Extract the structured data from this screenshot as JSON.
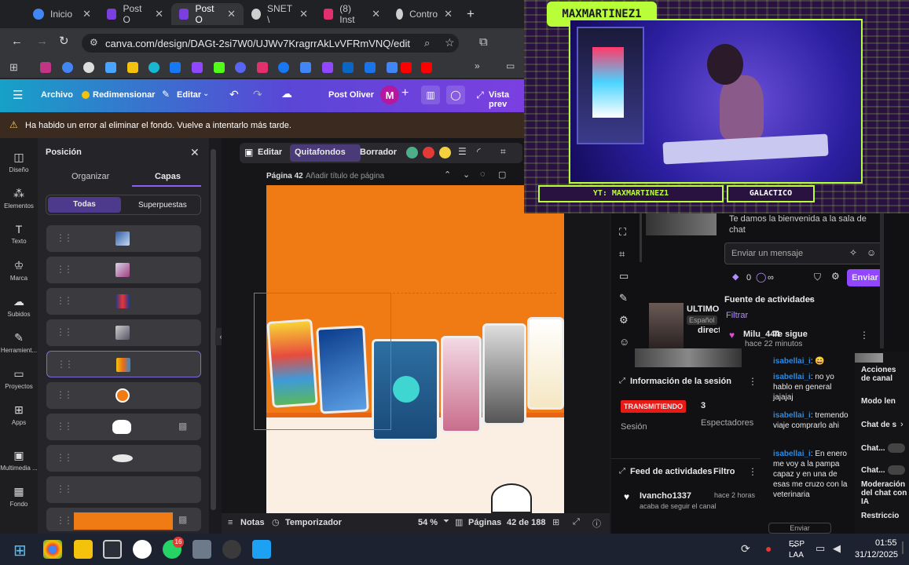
{
  "browser": {
    "tabs": [
      {
        "label": "Inicio",
        "fav_color": "#4285f4"
      },
      {
        "label": "Post O",
        "fav_color": "#7b3fe0"
      },
      {
        "label": "Post O",
        "fav_color": "#7b3fe0"
      },
      {
        "label": "SNET \\",
        "fav_color": "#cfcfcf"
      },
      {
        "label": "(8) Inst",
        "fav_color": "#e1306c"
      },
      {
        "label": "Contro",
        "fav_color": "#cfcfcf"
      }
    ],
    "new_tab": "+",
    "url": "canva.com/design/DAGt-2si7W0/UJWv7KragrrAkLvVFRmVNQ/edit"
  },
  "canva": {
    "menu": {
      "archivo": "Archivo",
      "redimensionar": "Redimensionar",
      "editar": "Editar",
      "title": "Post Oliver",
      "avatar": "M",
      "vista": "Vista prev"
    },
    "error": "Ha habido un error al eliminar el fondo. Vuelve a intentarlo más tarde.",
    "rail": [
      "Diseño",
      "Elementos",
      "Texto",
      "Marca",
      "Subidos",
      "Herramient...",
      "Proyectos",
      "Apps",
      "Multimedia ...",
      "Fondo"
    ],
    "panel": {
      "title": "Posición",
      "tab_organizar": "Organizar",
      "tab_capas": "Capas",
      "filter_todas": "Todas",
      "filter_superpuestas": "Superpuestas"
    },
    "edit_toolbar": {
      "editar": "Editar",
      "quitafondos": "Quitafondos",
      "borrador": "Borrador"
    },
    "page_label": "Página 42",
    "page_title_placeholder": "Añadir título de página",
    "bottom": {
      "notas": "Notas",
      "temporizador": "Temporizador",
      "zoom": "54 %",
      "paginas": "Páginas",
      "page_count": "42 de 188"
    }
  },
  "stream": {
    "username": "MAXMARTINEZ1",
    "yt_label": "YT: MAXMARTINEZ1",
    "tag": "GALACTICO",
    "welcome": "Te damos la bienvenida a la sala de chat",
    "chat_placeholder": "Enviar un mensaje",
    "send": "Enviar",
    "points": "0",
    "infinity": "∞",
    "activity_source": "Fuente de actividades",
    "filtrar": "Filtrar",
    "follow_event": {
      "user": "Milu_444",
      "action": "Te sigue",
      "time": "hace 22 minutos"
    },
    "partial_title": "ULTIMO I",
    "partial_lang": "Español",
    "partial_direct": "direct",
    "session": {
      "title": "Información de la sesión",
      "status": "TRANSMITIENDO",
      "viewers": "3",
      "session_label": "Sesión",
      "viewers_label": "Espectadores"
    },
    "activity_feed": {
      "title": "Feed de actividades",
      "filter": "Filtro",
      "user": "Ivancho1337",
      "time": "hace 2 horas",
      "action": "acaba de seguir el canal"
    },
    "chat": [
      {
        "user": "isabellai_i",
        "text": "😄"
      },
      {
        "user": "isabellai_i",
        "text": "no yo hablo en general jajajaj"
      },
      {
        "user": "isabellai_i",
        "text": "tremendo viaje comprarlo ahi"
      },
      {
        "user": "isabellai_i",
        "text": "En enero me voy a la pampa capaz y en una de esas me cruzo con la veterinaria"
      }
    ],
    "chat_send": "Enviar",
    "right_menu": [
      "Acciones de canal",
      "Modo len",
      "Chat de s",
      "Chat...",
      "Chat...",
      "Moderación del chat con IA",
      "Restriccio"
    ]
  },
  "taskbar": {
    "lang": "ESP",
    "layout": "LAA",
    "time": "01:55",
    "date": "31/12/2025",
    "badge": "16"
  }
}
